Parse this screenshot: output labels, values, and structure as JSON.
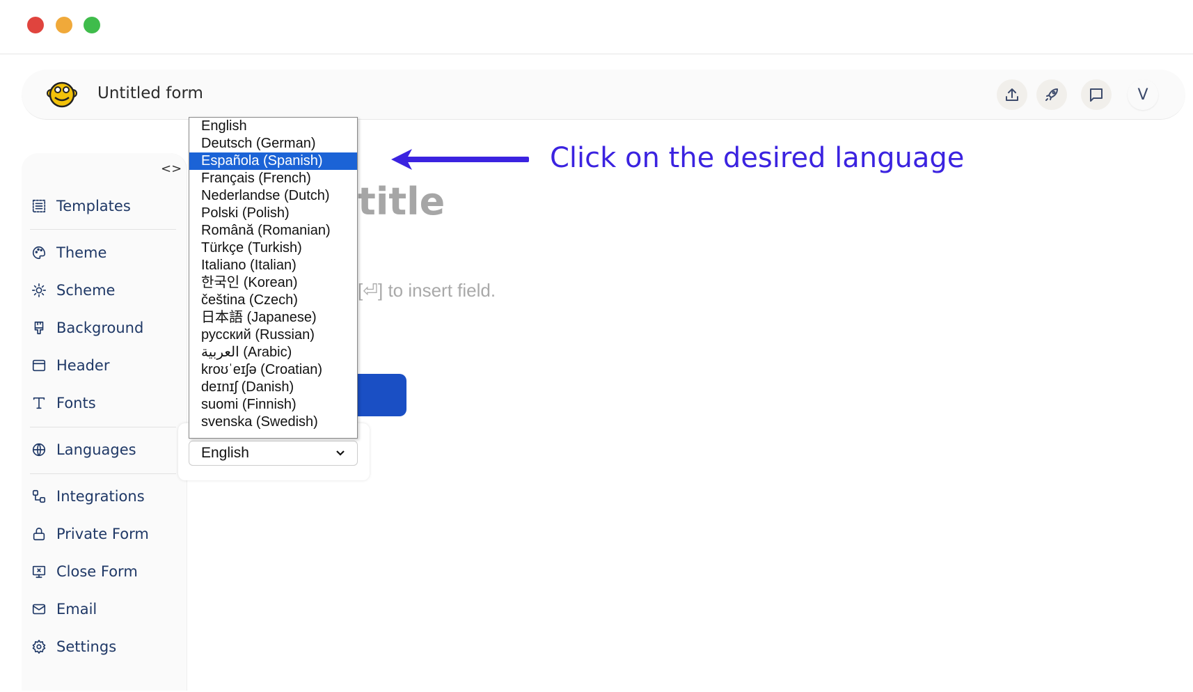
{
  "window": {
    "controls": [
      "close",
      "minimize",
      "maximize"
    ],
    "colors": {
      "close": "#e0443e",
      "minimize": "#f0a93a",
      "maximize": "#3fbc4b"
    }
  },
  "header": {
    "title": "Untitled form",
    "logo": "monkey-logo",
    "actions": [
      {
        "icon": "upload-icon"
      },
      {
        "icon": "rocket-icon"
      },
      {
        "icon": "chat-icon"
      }
    ],
    "avatar": "V"
  },
  "sidebar": {
    "toggle": "<>",
    "items": [
      {
        "label": "Templates",
        "icon": "templates-icon"
      },
      {
        "label": "Theme",
        "icon": "palette-icon"
      },
      {
        "label": "Scheme",
        "icon": "sun-icon"
      },
      {
        "label": "Background",
        "icon": "brush-icon"
      },
      {
        "label": "Header",
        "icon": "header-icon"
      },
      {
        "label": "Fonts",
        "icon": "type-icon"
      },
      {
        "label": "Languages",
        "icon": "globe-icon"
      },
      {
        "label": "Integrations",
        "icon": "integrations-icon"
      },
      {
        "label": "Private Form",
        "icon": "lock-icon"
      },
      {
        "label": "Close Form",
        "icon": "close-form-icon"
      },
      {
        "label": "Email",
        "icon": "mail-icon"
      },
      {
        "label": "Settings",
        "icon": "gear-icon"
      }
    ]
  },
  "canvas": {
    "title_fragment": "title",
    "hint": "[⏎] to insert field.",
    "button_color": "#1a4fc4"
  },
  "language_select": {
    "value": "English",
    "highlighted": "Española (Spanish)",
    "options": [
      "English",
      "Deutsch (German)",
      "Española (Spanish)",
      "Français (French)",
      "Nederlandse (Dutch)",
      "Polski (Polish)",
      "Română (Romanian)",
      "Türkçe (Turkish)",
      "Italiano (Italian)",
      "한국인 (Korean)",
      "čeština (Czech)",
      "日本語 (Japanese)",
      "русский (Russian)",
      "العربية (Arabic)",
      "kroʊˈeɪʃə (Croatian)",
      "deɪnɪʃ (Danish)",
      "suomi (Finnish)",
      "svenska (Swedish)"
    ]
  },
  "annotation": {
    "text": "Click on the desired language",
    "color": "#3b23e0"
  }
}
